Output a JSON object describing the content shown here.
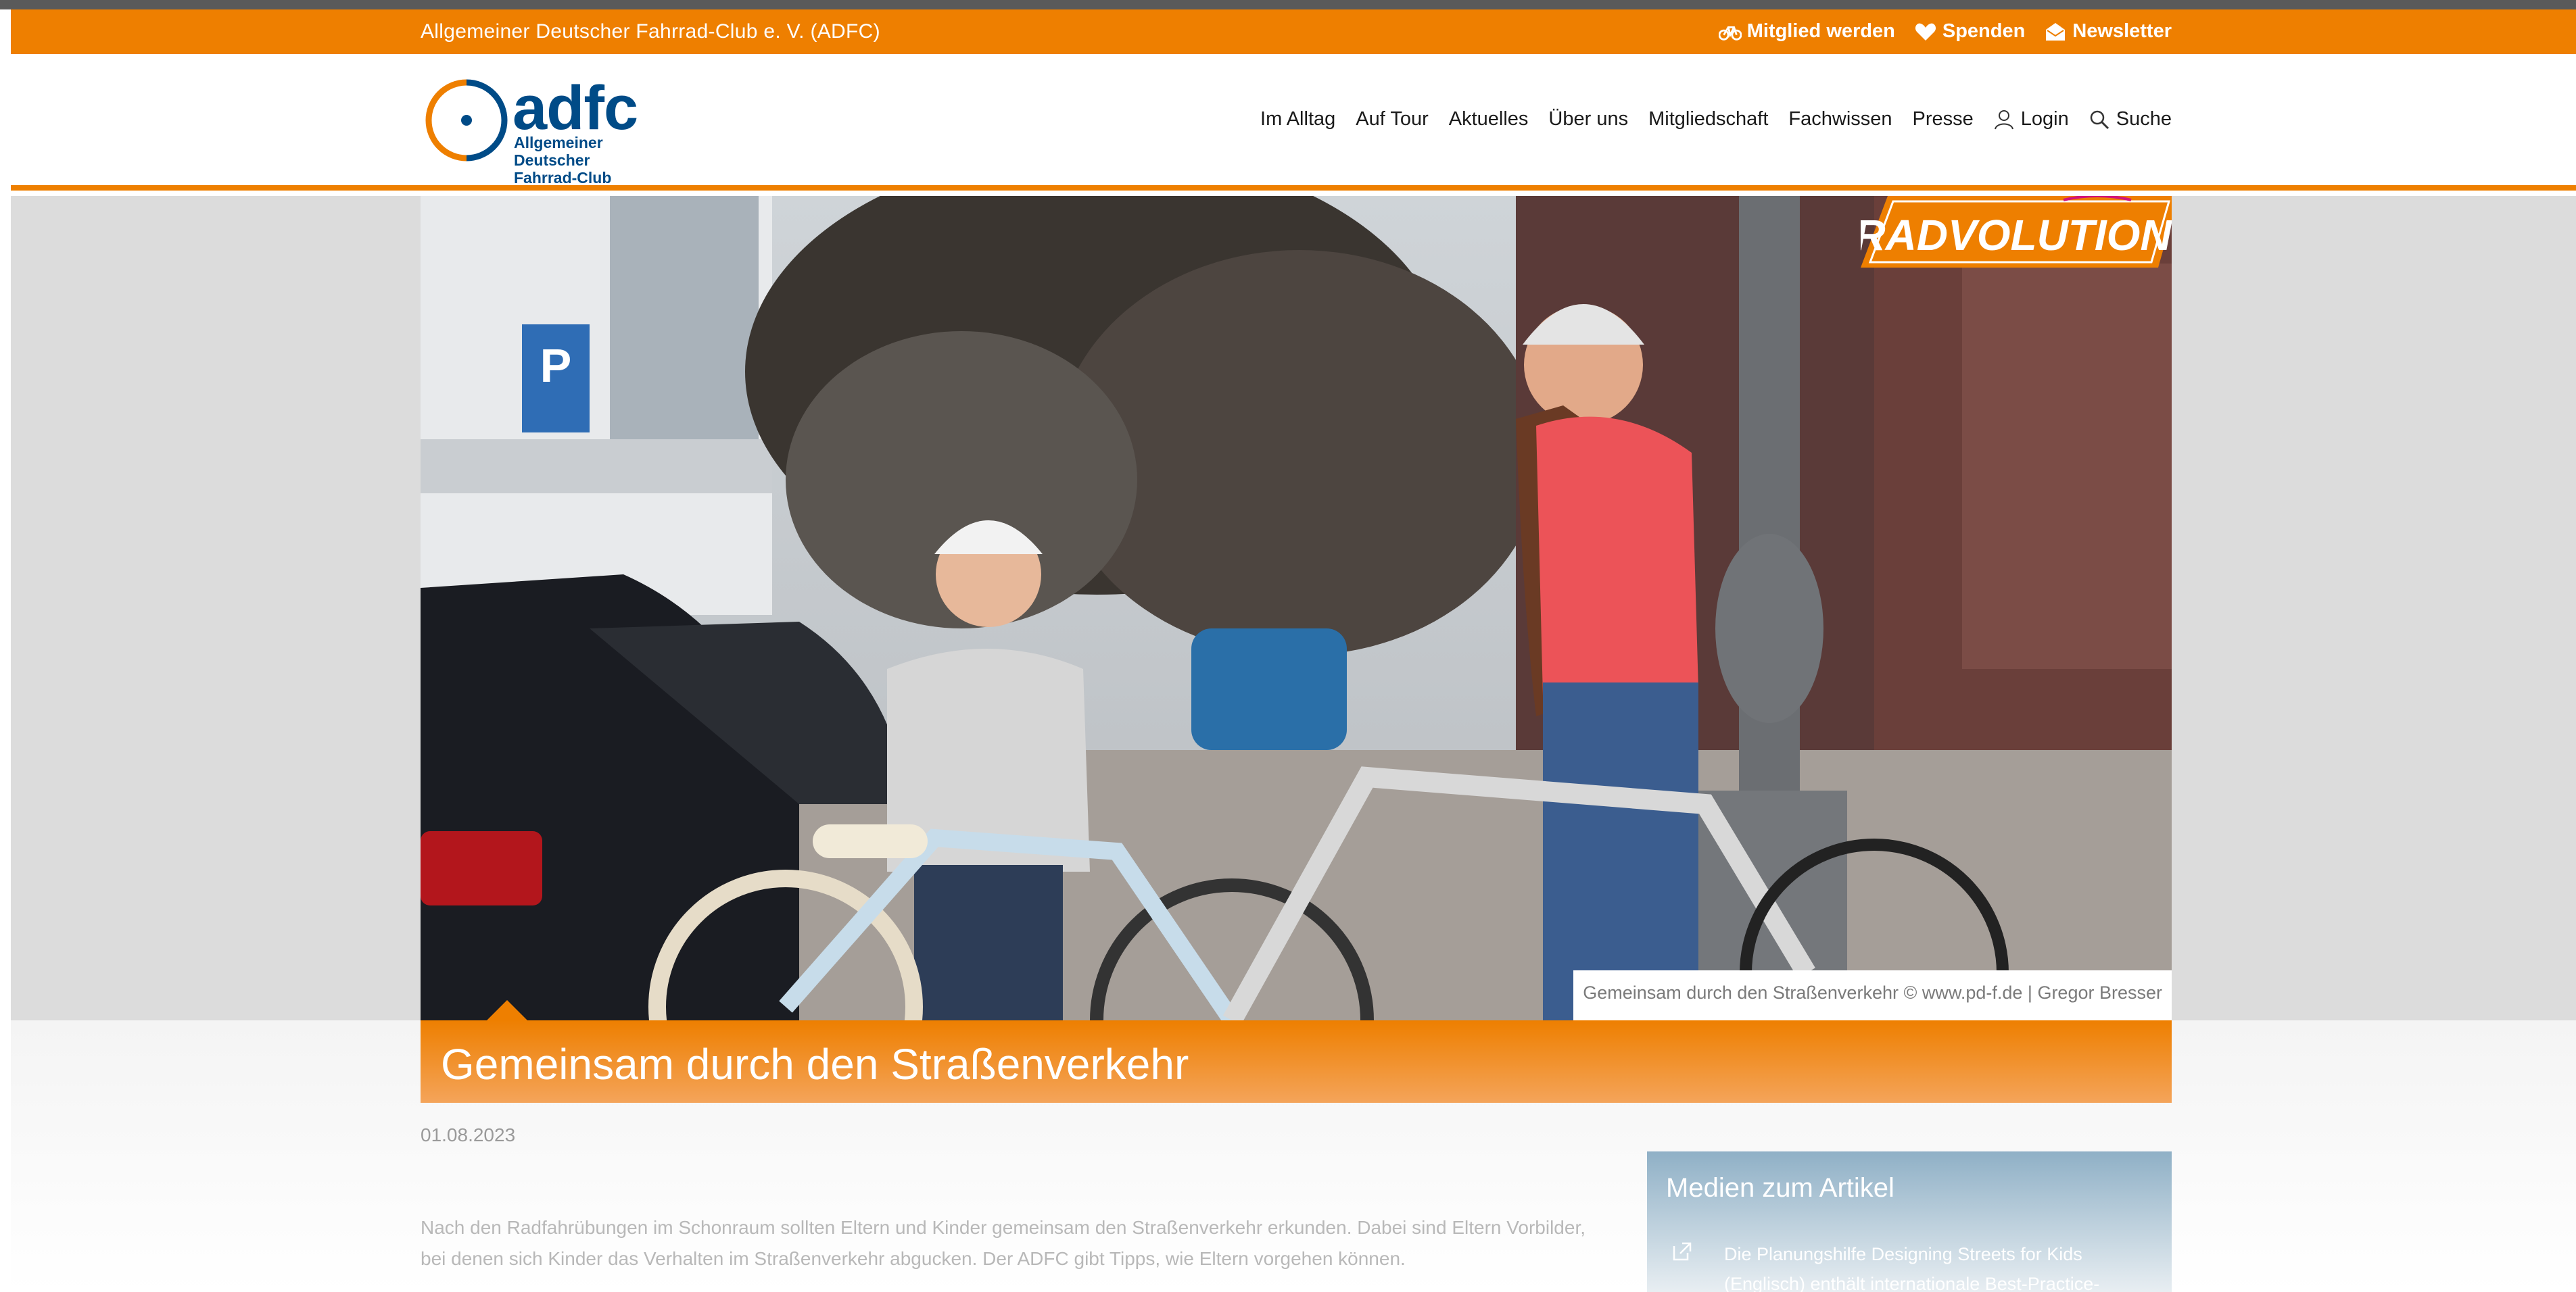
{
  "topbar": {
    "org_name": "Allgemeiner Deutscher Fahrrad-Club e. V. (ADFC)",
    "links": [
      {
        "label": "Mitglied werden",
        "icon": "bicycle-icon"
      },
      {
        "label": "Spenden",
        "icon": "heart-icon"
      },
      {
        "label": "Newsletter",
        "icon": "envelope-icon"
      }
    ]
  },
  "logo": {
    "word": "adfc",
    "line1": "Allgemeiner Deutscher",
    "line2": "Fahrrad-Club"
  },
  "nav": {
    "items": [
      "Im Alltag",
      "Auf Tour",
      "Aktuelles",
      "Über uns",
      "Mitgliedschaft",
      "Fachwissen",
      "Presse"
    ],
    "login": "Login",
    "search": "Suche"
  },
  "hero": {
    "caption": "Gemeinsam durch den Straßenverkehr © www.pd-f.de | Gregor Bresser",
    "badge": "RADVOLUTION"
  },
  "article": {
    "title": "Gemeinsam durch den Straßenverkehr",
    "date": "01.08.2023",
    "intro": "Nach den Radfahrübungen im Schonraum sollten Eltern und Kinder gemeinsam den Straßenverkehr erkunden. Dabei sind Eltern Vorbilder, bei denen sich Kinder das Verhalten im Straßenverkehr abgucken. Der ADFC gibt Tipps, wie Eltern vorgehen können."
  },
  "media": {
    "heading": "Medien zum Artikel",
    "item": "Die Planungshilfe Designing Streets for Kids (Englisch) enthält internationale Best-Practice-"
  },
  "colors": {
    "brand_orange": "#ee7f00",
    "brand_blue": "#004b87",
    "media_blue": "#8fb0c6"
  }
}
